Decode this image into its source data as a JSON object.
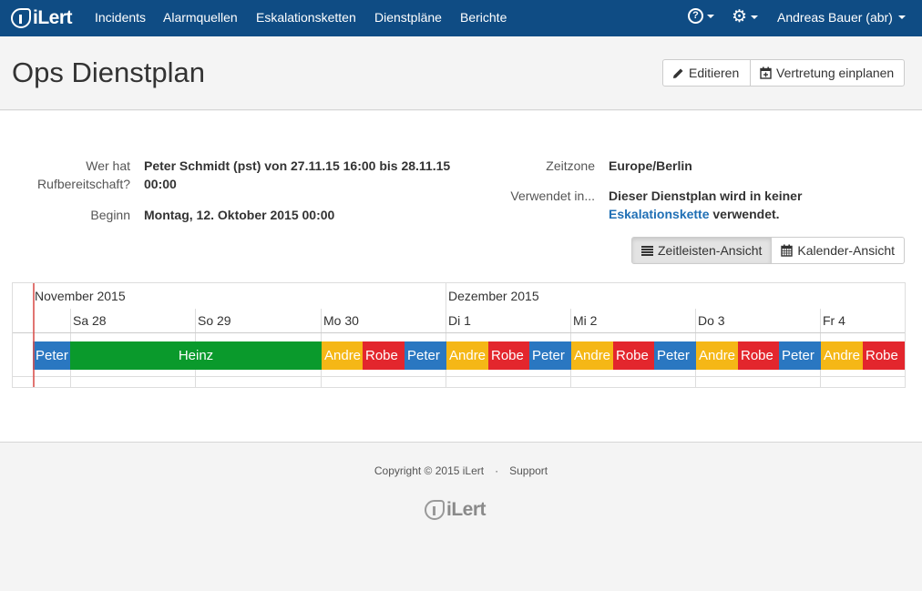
{
  "nav": {
    "brand": "iLert",
    "links": [
      "Incidents",
      "Alarmquellen",
      "Eskalationsketten",
      "Dienstpläne",
      "Berichte"
    ],
    "user": "Andreas Bauer (abr)",
    "help_icon": "question-circle-icon",
    "settings_icon": "gear-icon"
  },
  "header": {
    "title": "Ops Dienstplan",
    "edit_label": "Editieren",
    "vertretung_label": "Vertretung einplanen"
  },
  "details": {
    "oncall_label_1": "Wer hat",
    "oncall_label_2": "Rufbereitschaft?",
    "oncall_value_1": "Peter Schmidt (pst) von 27.11.15 16:00 bis 28.11.15",
    "oncall_value_2": "00:00",
    "start_label": "Beginn",
    "start_value": "Montag, 12. Oktober 2015 00:00",
    "timezone_label": "Zeitzone",
    "timezone_value": "Europe/Berlin",
    "used_label": "Verwendet in...",
    "used_value_1": "Dieser Dienstplan wird in keiner",
    "used_link": "Eskalationskette",
    "used_value_2": "verwendet."
  },
  "views": {
    "timeline_label": "Zeitleisten-Ansicht",
    "calendar_label": "Kalender-Ansicht"
  },
  "timeline": {
    "months": [
      "November 2015",
      "Dezember 2015"
    ],
    "days": [
      "Sa 28",
      "So 29",
      "Mo 30",
      "Di 1",
      "Mi 2",
      "Do 3",
      "Fr 4"
    ],
    "shifts": [
      {
        "label": "Peter",
        "color": "#2a77c1"
      },
      {
        "label": "Heinz",
        "color": "#0a9a2c"
      },
      {
        "label": "Andre",
        "color": "#f5b716"
      },
      {
        "label": "Robe",
        "color": "#e3262d"
      },
      {
        "label": "Peter",
        "color": "#2a77c1"
      },
      {
        "label": "Andre",
        "color": "#f5b716"
      },
      {
        "label": "Robe",
        "color": "#e3262d"
      },
      {
        "label": "Peter",
        "color": "#2a77c1"
      },
      {
        "label": "Andre",
        "color": "#f5b716"
      },
      {
        "label": "Robe",
        "color": "#e3262d"
      },
      {
        "label": "Peter",
        "color": "#2a77c1"
      },
      {
        "label": "Andre",
        "color": "#f5b716"
      },
      {
        "label": "Robe",
        "color": "#e3262d"
      },
      {
        "label": "Peter",
        "color": "#2a77c1"
      },
      {
        "label": "Andre",
        "color": "#f5b716"
      },
      {
        "label": "Robe",
        "color": "#e3262d"
      }
    ]
  },
  "footer": {
    "copyright": "Copyright © 2015 iLert",
    "separator": "·",
    "support": "Support",
    "brand": "iLert"
  }
}
